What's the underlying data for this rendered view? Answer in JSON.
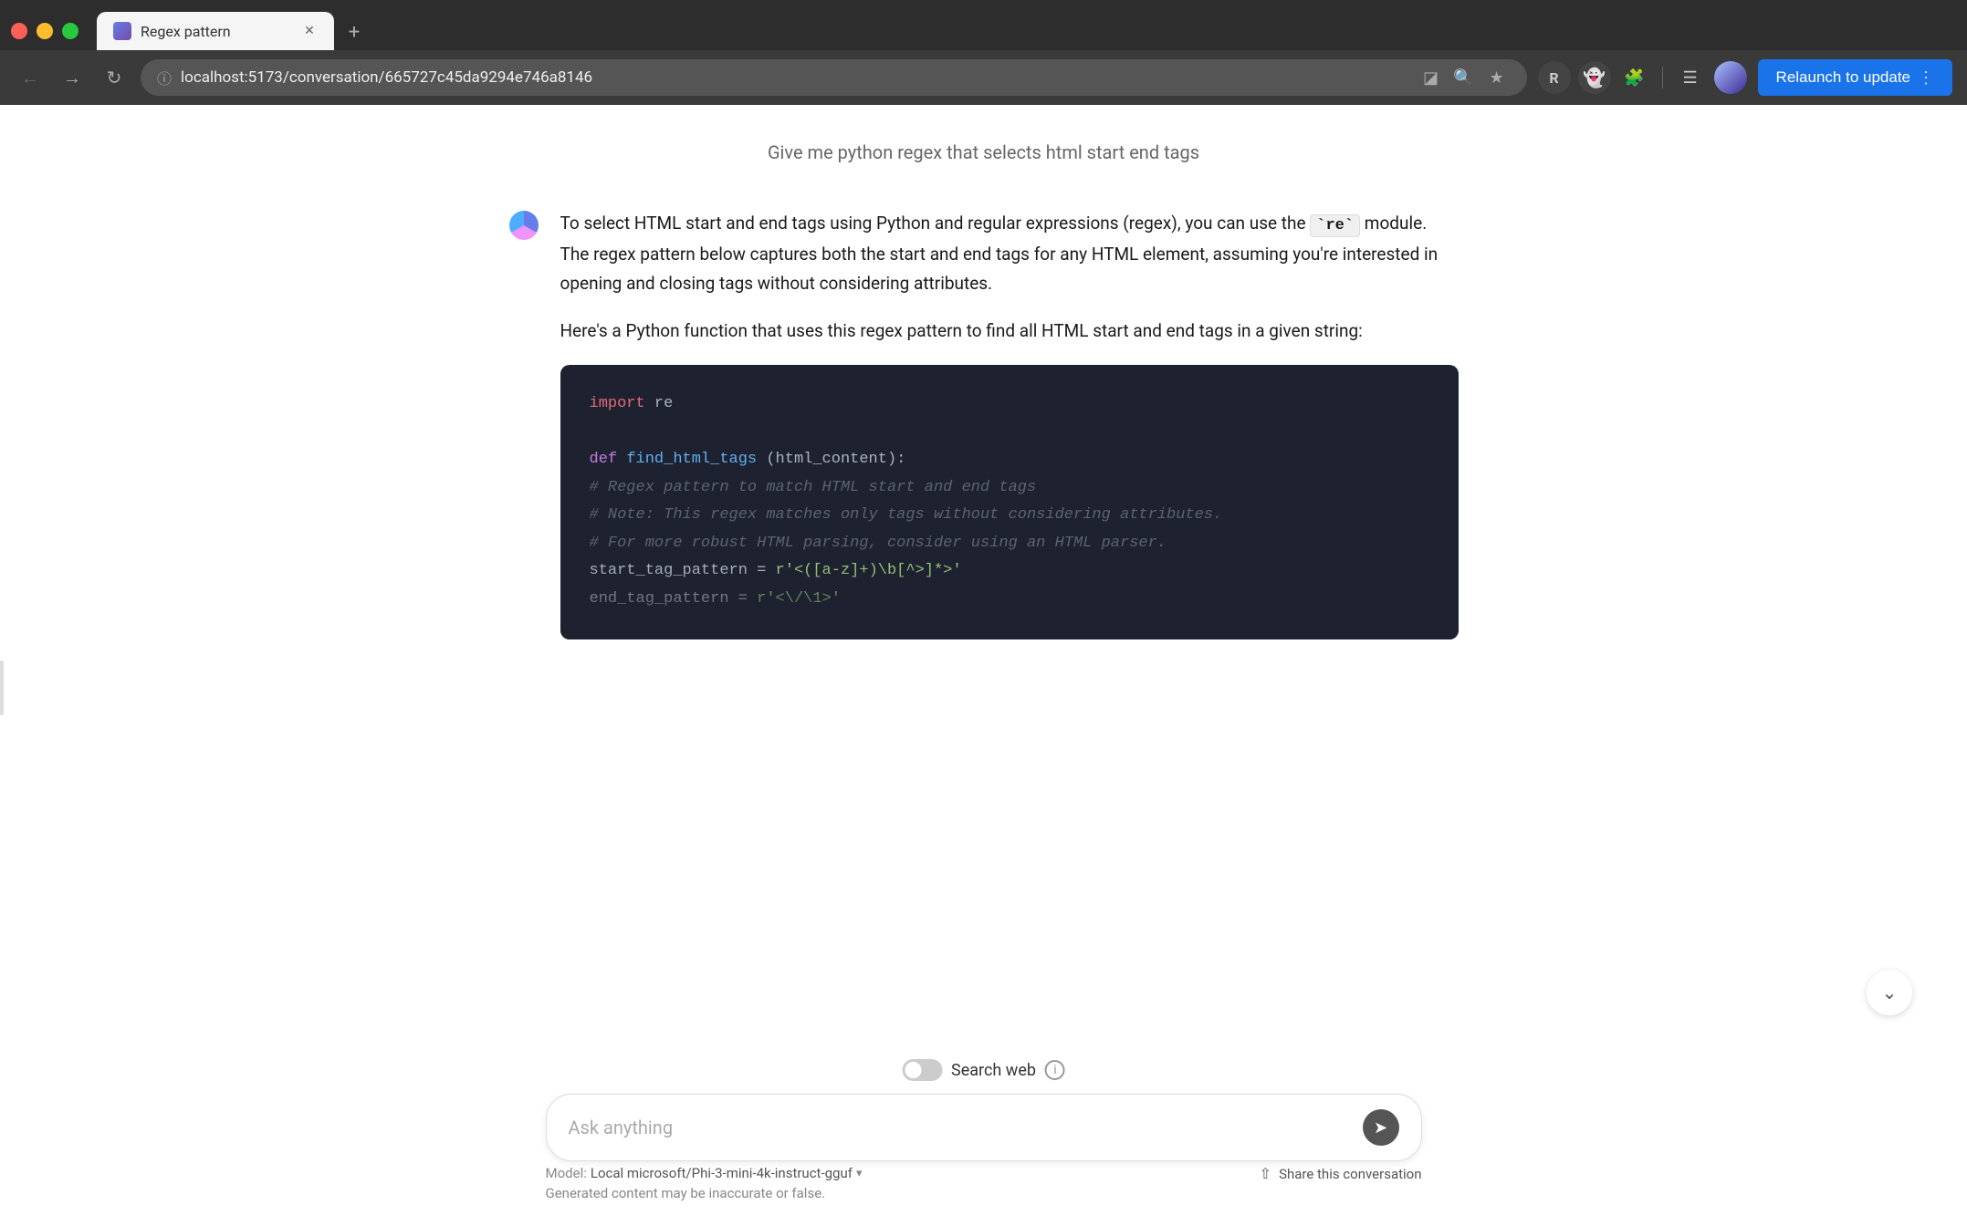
{
  "browser": {
    "tab_title": "Regex pattern",
    "tab_icon": "chat-icon",
    "url": "localhost:5173/conversation/665727c45da9294e746a8146",
    "relaunch_label": "Relaunch to update",
    "new_tab_label": "+"
  },
  "conversation": {
    "user_message": "Give me python regex that selects html start end tags",
    "assistant_intro_p1": "To select HTML start and end tags using Python and regular expressions (regex), you can use the ",
    "inline_code": "`re`",
    "assistant_intro_p1_cont": " module. The regex pattern below captures both the start and end tags for any HTML element, assuming you're interested in opening and closing tags without considering attributes.",
    "assistant_intro_p2": "Here's a Python function that uses this regex pattern to find all HTML start and end tags in a given string:",
    "code_lines": [
      {
        "type": "import",
        "content": "import re"
      },
      {
        "type": "blank",
        "content": ""
      },
      {
        "type": "def",
        "content": "def find_html_tags(html_content):"
      },
      {
        "type": "comment",
        "content": "    # Regex pattern to match HTML start and end tags"
      },
      {
        "type": "comment",
        "content": "    # Note: This regex matches only tags without considering attributes."
      },
      {
        "type": "comment",
        "content": "    # For more robust HTML parsing, consider using an HTML parser."
      },
      {
        "type": "code",
        "content": "    start_tag_pattern = r'<([a-z]+)\\b[^>]*>'"
      },
      {
        "type": "code",
        "content": "    end_tag_pattern = r'<\\/\\1>'"
      }
    ]
  },
  "search_web": {
    "label": "Search web",
    "toggle_state": "off"
  },
  "input": {
    "placeholder": "Ask anything"
  },
  "footer": {
    "model_prefix": "Model:",
    "model_name": "Local microsoft/Phi-3-mini-4k-instruct-gguf",
    "warning": "Generated content may be inaccurate or false.",
    "share_label": "Share this conversation"
  }
}
